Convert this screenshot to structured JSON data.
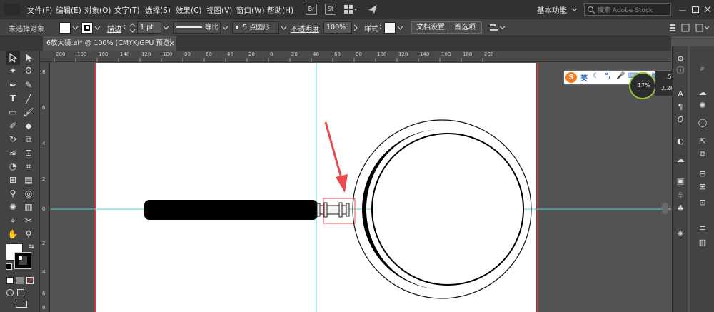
{
  "menu": [
    "文件(F)",
    "编辑(E)",
    "对象(O)",
    "文字(T)",
    "选择(S)",
    "效果(C)",
    "视图(V)",
    "窗口(W)",
    "帮助(H)"
  ],
  "menu_icons": {
    "br": "Br",
    "st": "St"
  },
  "workspace": "基本功能",
  "search": {
    "placeholder": "搜索 Adobe Stock"
  },
  "options": {
    "no_selection": "未选择对象",
    "stroke_label": "描边",
    "stroke_value": "1 pt",
    "profile_label": "等比",
    "brush_label": "5 点圆形",
    "opacity_label": "不透明度",
    "opacity_value": "100%",
    "style_label": "样式",
    "doc_setup": "文档设置",
    "preferences": "首选项"
  },
  "tab": {
    "title": "6放大镜.ai* @ 100% (CMYK/GPU 预览)",
    "close": "×"
  },
  "ruler": {
    "h_ticks": [
      "200",
      "180",
      "160",
      "140",
      "120",
      "100",
      "80",
      "60",
      "40",
      "20",
      "0",
      "20",
      "40",
      "60",
      "80",
      "100",
      "120",
      "140",
      "160",
      "180",
      "200"
    ],
    "v_ticks": [
      "8",
      "6",
      "4",
      "2",
      "0",
      "2",
      "4",
      "6",
      "8"
    ]
  },
  "ime": {
    "brand": "S",
    "lang": "英",
    "speed_up": ".5K/s",
    "speed_down": "2.2K/s",
    "speed_meter": "17%"
  },
  "colors": {
    "menubar": "#323232",
    "panel": "#434343",
    "workspace": "#535353",
    "guide": "#4fd3e0",
    "selection": "#e8484f",
    "arrow": "#e8484f",
    "ime_blue": "#2b6cc4",
    "sogou_orange": "#f47920"
  }
}
